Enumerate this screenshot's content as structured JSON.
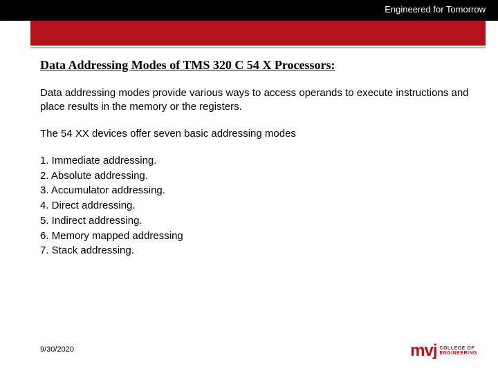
{
  "header": {
    "tagline": "Engineered for Tomorrow"
  },
  "slide": {
    "title": "Data Addressing Modes of TMS 320 C 54 X Processors:",
    "intro": "Data addressing modes provide various ways to access operands to execute instructions and place results in the memory or the registers.",
    "subtitle": "The 54 XX devices offer seven basic addressing modes",
    "modes": [
      "1. Immediate addressing.",
      "2. Absolute addressing.",
      "3. Accumulator addressing.",
      "4. Direct addressing.",
      "5. Indirect addressing.",
      "6. Memory mapped addressing",
      "7. Stack addressing."
    ]
  },
  "footer": {
    "date": "9/30/2020",
    "logo_mark": "mvj",
    "logo_line1": "COLLEGE OF",
    "logo_line2": "ENGINEERING"
  }
}
